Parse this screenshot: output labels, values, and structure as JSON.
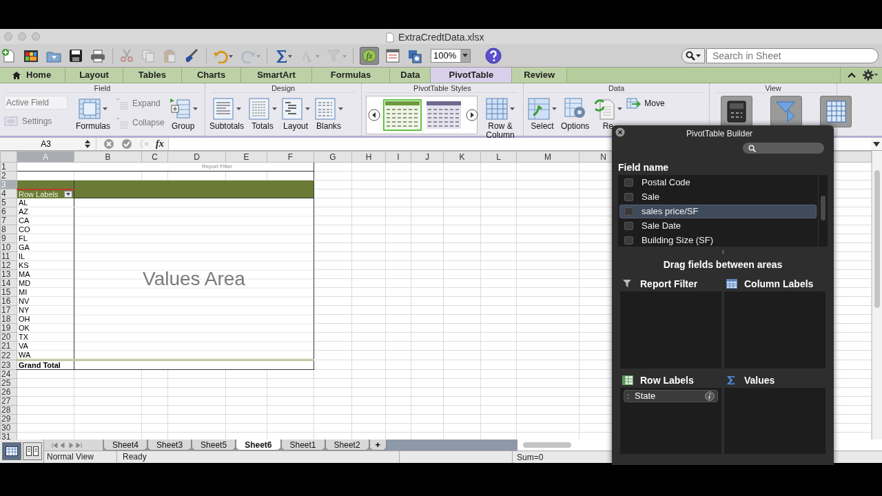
{
  "window": {
    "title": "ExtraCredtData.xlsx"
  },
  "toolbar": {
    "items": [
      {
        "kind": "new",
        "disabled": false
      },
      {
        "kind": "templates",
        "disabled": false
      },
      {
        "kind": "open",
        "disabled": false
      },
      {
        "kind": "save",
        "disabled": false
      },
      {
        "kind": "print",
        "disabled": false
      },
      {
        "kind": "cut",
        "disabled": true
      },
      {
        "kind": "copy",
        "disabled": true
      },
      {
        "kind": "paste",
        "disabled": true
      },
      {
        "kind": "brush",
        "disabled": false
      },
      {
        "kind": "undo",
        "disabled": false
      },
      {
        "kind": "redo",
        "disabled": true
      },
      {
        "kind": "sum",
        "disabled": false
      },
      {
        "kind": "sort",
        "disabled": true
      },
      {
        "kind": "filter",
        "disabled": true
      },
      {
        "kind": "formula_builder",
        "label": "fx",
        "on": true
      },
      {
        "kind": "toolbox",
        "disabled": false
      },
      {
        "kind": "media",
        "disabled": false
      }
    ],
    "zoom": "100%",
    "search": {
      "placeholder": "Search in Sheet"
    }
  },
  "ribbon_tabs": [
    {
      "label": "Home",
      "selected": false
    },
    {
      "label": "Layout",
      "selected": false
    },
    {
      "label": "Tables",
      "selected": false
    },
    {
      "label": "Charts",
      "selected": false
    },
    {
      "label": "SmartArt",
      "selected": false
    },
    {
      "label": "Formulas",
      "selected": false
    },
    {
      "label": "Data",
      "selected": false
    },
    {
      "label": "PivotTable",
      "selected": true
    },
    {
      "label": "Review",
      "selected": false
    }
  ],
  "ribbon_groups": [
    {
      "title": "Field",
      "columns": [
        [
          {
            "kind": "field",
            "label": "Active Field"
          },
          {
            "kind": "small",
            "label": "Settings",
            "disabled": true
          }
        ],
        [
          {
            "kind": "large",
            "label": "Formulas",
            "dropdown": true
          }
        ],
        [
          {
            "kind": "small",
            "label": "Expand",
            "disabled": true
          },
          {
            "kind": "small",
            "label": "Collapse",
            "disabled": true
          }
        ],
        [
          {
            "kind": "large",
            "label": "Group",
            "dropdown": true
          }
        ]
      ]
    },
    {
      "title": "Design",
      "columns": [
        [
          {
            "kind": "large",
            "label": "Subtotals",
            "dropdown": true
          }
        ],
        [
          {
            "kind": "large",
            "label": "Totals",
            "dropdown": true
          }
        ],
        [
          {
            "kind": "large",
            "label": "Layout",
            "dropdown": true
          }
        ],
        [
          {
            "kind": "large",
            "label": "Blanks",
            "dropdown": true
          }
        ]
      ]
    },
    {
      "title": "PivotTable Styles",
      "columns": [
        [
          {
            "kind": "gallery",
            "styles": [
              {
                "selected": true
              },
              {
                "selected": false
              }
            ]
          }
        ],
        [
          {
            "kind": "large",
            "label": "Row & Column",
            "dropdown": true
          }
        ]
      ]
    },
    {
      "title": "Data",
      "columns": [
        [
          {
            "kind": "large",
            "label": "Select",
            "dropdown": true
          }
        ],
        [
          {
            "kind": "large",
            "label": "Options",
            "dropdown": false
          }
        ],
        [
          {
            "kind": "large",
            "label": "Re",
            "dropdown": true
          }
        ],
        [
          {
            "kind": "small",
            "label": "Move",
            "disabled": false
          }
        ]
      ]
    },
    {
      "title": "View",
      "columns": [
        [
          {
            "kind": "icon"
          }
        ],
        [
          {
            "kind": "icon"
          }
        ],
        [
          {
            "kind": "icon"
          }
        ]
      ]
    }
  ],
  "formula_bar": {
    "name_box": "A3",
    "function_label": "fx"
  },
  "sheet": {
    "columns": [
      {
        "label": "A",
        "selected": true
      },
      {
        "label": "B",
        "selected": false
      },
      {
        "label": "C",
        "selected": false
      },
      {
        "label": "D",
        "selected": false
      },
      {
        "label": "E",
        "selected": false
      },
      {
        "label": "F",
        "selected": false
      },
      {
        "label": "G",
        "selected": false
      },
      {
        "label": "H",
        "selected": false
      },
      {
        "label": "I",
        "selected": false
      },
      {
        "label": "J",
        "selected": false
      },
      {
        "label": "K",
        "selected": false
      },
      {
        "label": "L",
        "selected": false
      },
      {
        "label": "M",
        "selected": false
      },
      {
        "label": "N",
        "selected": false
      }
    ],
    "rows": [
      {
        "label": "1",
        "selected": false
      },
      {
        "label": "2",
        "selected": false
      },
      {
        "label": "3",
        "selected": true
      },
      {
        "label": "4",
        "selected": false
      },
      {
        "label": "5",
        "selected": false
      },
      {
        "label": "6",
        "selected": false
      },
      {
        "label": "7",
        "selected": false
      },
      {
        "label": "8",
        "selected": false
      },
      {
        "label": "9",
        "selected": false
      },
      {
        "label": "10",
        "selected": false
      },
      {
        "label": "11",
        "selected": false
      },
      {
        "label": "12",
        "selected": false
      },
      {
        "label": "13",
        "selected": false
      },
      {
        "label": "14",
        "selected": false
      },
      {
        "label": "15",
        "selected": false
      },
      {
        "label": "16",
        "selected": false
      },
      {
        "label": "17",
        "selected": false
      },
      {
        "label": "18",
        "selected": false
      },
      {
        "label": "19",
        "selected": false
      },
      {
        "label": "20",
        "selected": false
      },
      {
        "label": "21",
        "selected": false
      },
      {
        "label": "22",
        "selected": false
      },
      {
        "label": "23",
        "selected": false
      },
      {
        "label": "24",
        "selected": false
      },
      {
        "label": "25",
        "selected": false
      },
      {
        "label": "26",
        "selected": false
      },
      {
        "label": "27",
        "selected": false
      },
      {
        "label": "28",
        "selected": false
      },
      {
        "label": "29",
        "selected": false
      },
      {
        "label": "30",
        "selected": false
      },
      {
        "label": "31",
        "selected": false
      }
    ],
    "pivot": {
      "report_filter": "Report Filter",
      "row_labels_header": "Row Labels",
      "row_items": [
        "AL",
        "AZ",
        "CA",
        "CO",
        "FL",
        "GA",
        "IL",
        "KS",
        "MA",
        "MD",
        "MI",
        "NV",
        "NY",
        "OH",
        "OK",
        "TX",
        "VA",
        "WA"
      ],
      "values_area": "Values Area",
      "grand_total": "Grand Total"
    }
  },
  "sheet_tabs": [
    {
      "label": "Sheet4",
      "selected": false
    },
    {
      "label": "Sheet3",
      "selected": false
    },
    {
      "label": "Sheet5",
      "selected": false
    },
    {
      "label": "Sheet6",
      "selected": true
    },
    {
      "label": "Sheet1",
      "selected": false
    },
    {
      "label": "Sheet2",
      "selected": false
    }
  ],
  "add_sheet_label": "+",
  "status_bar": {
    "view_buttons": [
      {
        "selected": true
      },
      {
        "selected": false
      }
    ],
    "view": "Normal View",
    "status": "Ready",
    "sum": "Sum=0"
  },
  "pivot_builder": {
    "title": "PivotTable Builder",
    "field_heading": "Field name",
    "fields": [
      {
        "label": "Postal Code",
        "checked": false,
        "selected": false
      },
      {
        "label": "Sale",
        "checked": false,
        "selected": false
      },
      {
        "label": "sales price/SF",
        "checked": false,
        "selected": true
      },
      {
        "label": "Sale Date",
        "checked": false,
        "selected": false
      },
      {
        "label": "Building Size (SF)",
        "checked": false,
        "selected": false
      }
    ],
    "hint": "Drag fields between areas",
    "areas": [
      {
        "label": "Report Filter"
      },
      {
        "label": "Column Labels"
      },
      {
        "label": "Row Labels",
        "items": [
          {
            "label": "State"
          }
        ]
      },
      {
        "label": "Values"
      }
    ]
  }
}
